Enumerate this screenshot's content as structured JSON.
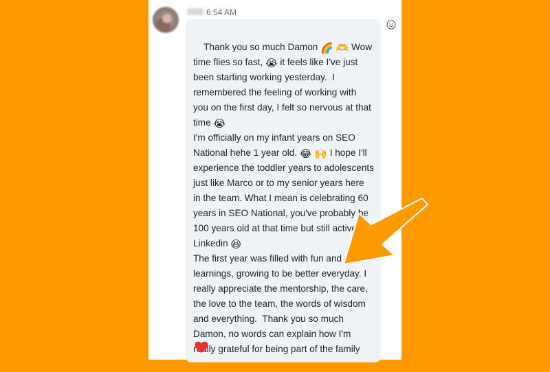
{
  "message": {
    "timestamp": "6:54 AM",
    "parts": [
      "Thank you so much Damon ",
      "🌈",
      " ",
      "🫶",
      " Wow\ntime flies so fast, ",
      "😭",
      " it feels like I've just\nbeen starting working yesterday.  I\nremembered the feeling of working with\nyou on the first day, I felt so nervous at that\ntime ",
      "😭",
      "\nI'm officially on my infant years on SEO\nNational hehe 1 year old. ",
      "😂",
      " ",
      "🙌",
      " I hope I'll\nexperience the toddler years to adolescents\njust like Marco or to my senior years here\nin the team. What I mean is celebrating 60\nyears in SEO National, you've probably be\n100 years old at that time but still active on\nLinkedin ",
      "😆",
      "\nThe first year was filled with fun and\nlearnings, growing to be better everyday. I\nreally appreciate the mentorship, the care,\nthe love to the team, the words of wisdom\nand everything.  Thank you so much\nDamon, no words can explain how I'm\nreally grateful for being part of the family"
    ]
  },
  "colors": {
    "background": "#FF9900",
    "bubble": "#f0f3f6",
    "heart": "#e8322e",
    "arrow": "#FF9900"
  },
  "icons": {
    "heart": "heart-icon",
    "react": "smiley-icon",
    "arrow": "arrow-icon"
  }
}
